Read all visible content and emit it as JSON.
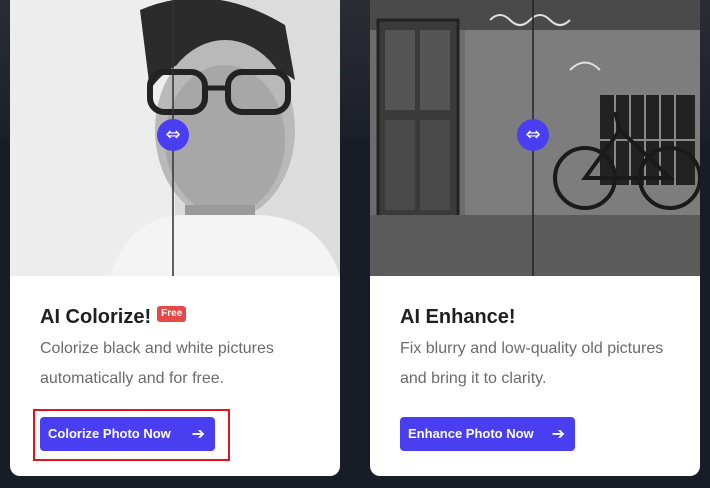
{
  "cards": [
    {
      "title": "AI Colorize!",
      "badge": "Free",
      "description": "Colorize black and white pictures automatically and for free.",
      "button_label": "Colorize Photo Now",
      "image_subject": "portrait of man with glasses (before/after comparison)"
    },
    {
      "title": "AI Enhance!",
      "description": "Fix blurry and low-quality old pictures and bring it to clarity.",
      "button_label": "Enhance Photo Now",
      "image_subject": "old wall with door, window and bicycle (before/after comparison)"
    }
  ],
  "icons": {
    "slider_handle": "double-arrow-icon",
    "button_arrow": "arrow-right-icon"
  },
  "colors": {
    "accent": "#4a3ff0",
    "badge": "#e84848",
    "highlight": "#e0141e",
    "background": "#181c26"
  }
}
